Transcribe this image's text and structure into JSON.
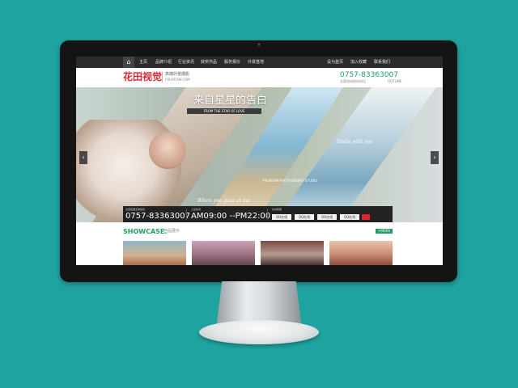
{
  "nav": {
    "items": [
      "主页",
      "品牌介绍",
      "行业资讯",
      "获奖作品",
      "服务报价",
      "外景基地"
    ],
    "right_items": [
      "设为首页",
      "加入收藏",
      "联系我们"
    ]
  },
  "header": {
    "logo": "花田视觉",
    "tagline": "高端外景摄影",
    "domain": "FHUATIAN.COM",
    "phone": "0757-83363007",
    "phone_sub": "全国咨询热线电话",
    "hotline": "HOTLINE"
  },
  "banner": {
    "title": "来自星星的告白",
    "subtitle": "FROM THE STAR OF LOVE",
    "script_1": "When you gaze at me",
    "script_2": "Smile with me",
    "studio": "FHUATIAN PHOTOGRAPHY STUDIO",
    "prev": "‹",
    "next": "›"
  },
  "contact": {
    "phone_label": "全国客服咨询热线",
    "phone": "0757-83363007",
    "hours_label": "上班时间",
    "hours": "AM09:00 --PM22:00",
    "online_label": "在线客服",
    "qq": [
      "QQ在线",
      "QQ在线",
      "QQ在线",
      "QQ在线"
    ]
  },
  "showcase": {
    "title": "SHOWCASE.",
    "title_cn": "作品展示",
    "more": "+MORE"
  },
  "colors": {
    "background": "#1fa3a0",
    "brand_red": "#e0242f",
    "accent_green": "#1f9e63",
    "nav_bg": "#2b2b2b"
  }
}
